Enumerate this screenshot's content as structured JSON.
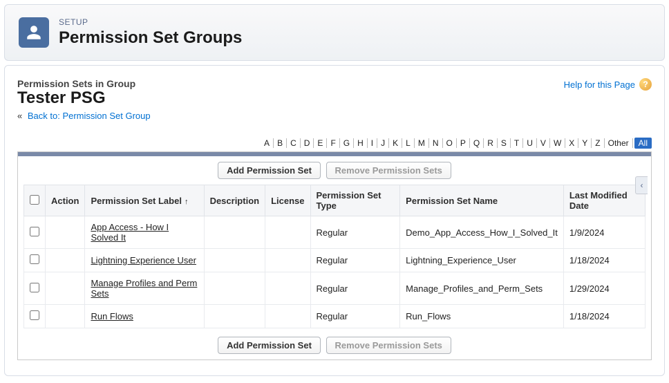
{
  "header": {
    "crumb": "SETUP",
    "title": "Permission Set Groups"
  },
  "section": {
    "label": "Permission Sets in Group",
    "group_name": "Tester PSG"
  },
  "back_link": {
    "laquo": "«",
    "label": "Back to: Permission Set Group"
  },
  "help": {
    "label": "Help for this Page",
    "icon_glyph": "?"
  },
  "alpha": {
    "letters": [
      "A",
      "B",
      "C",
      "D",
      "E",
      "F",
      "G",
      "H",
      "I",
      "J",
      "K",
      "L",
      "M",
      "N",
      "O",
      "P",
      "Q",
      "R",
      "S",
      "T",
      "U",
      "V",
      "W",
      "X",
      "Y",
      "Z"
    ],
    "other": "Other",
    "all": "All"
  },
  "buttons": {
    "add": "Add Permission Set",
    "remove": "Remove Permission Sets"
  },
  "columns": {
    "action": "Action",
    "label": "Permission Set Label",
    "description": "Description",
    "license": "License",
    "type": "Permission Set Type",
    "name": "Permission Set Name",
    "modified": "Last Modified Date"
  },
  "sort_arrow": "↑",
  "rows": [
    {
      "label": "App Access - How I Solved It",
      "description": "",
      "license": "",
      "type": "Regular",
      "name": "Demo_App_Access_How_I_Solved_It",
      "modified": "1/9/2024"
    },
    {
      "label": "Lightning Experience User",
      "description": "",
      "license": "",
      "type": "Regular",
      "name": "Lightning_Experience_User",
      "modified": "1/18/2024"
    },
    {
      "label": "Manage Profiles and Perm Sets",
      "description": "",
      "license": "",
      "type": "Regular",
      "name": "Manage_Profiles_and_Perm_Sets",
      "modified": "1/29/2024"
    },
    {
      "label": "Run Flows",
      "description": "",
      "license": "",
      "type": "Regular",
      "name": "Run_Flows",
      "modified": "1/18/2024"
    }
  ],
  "side_tab_glyph": "‹"
}
